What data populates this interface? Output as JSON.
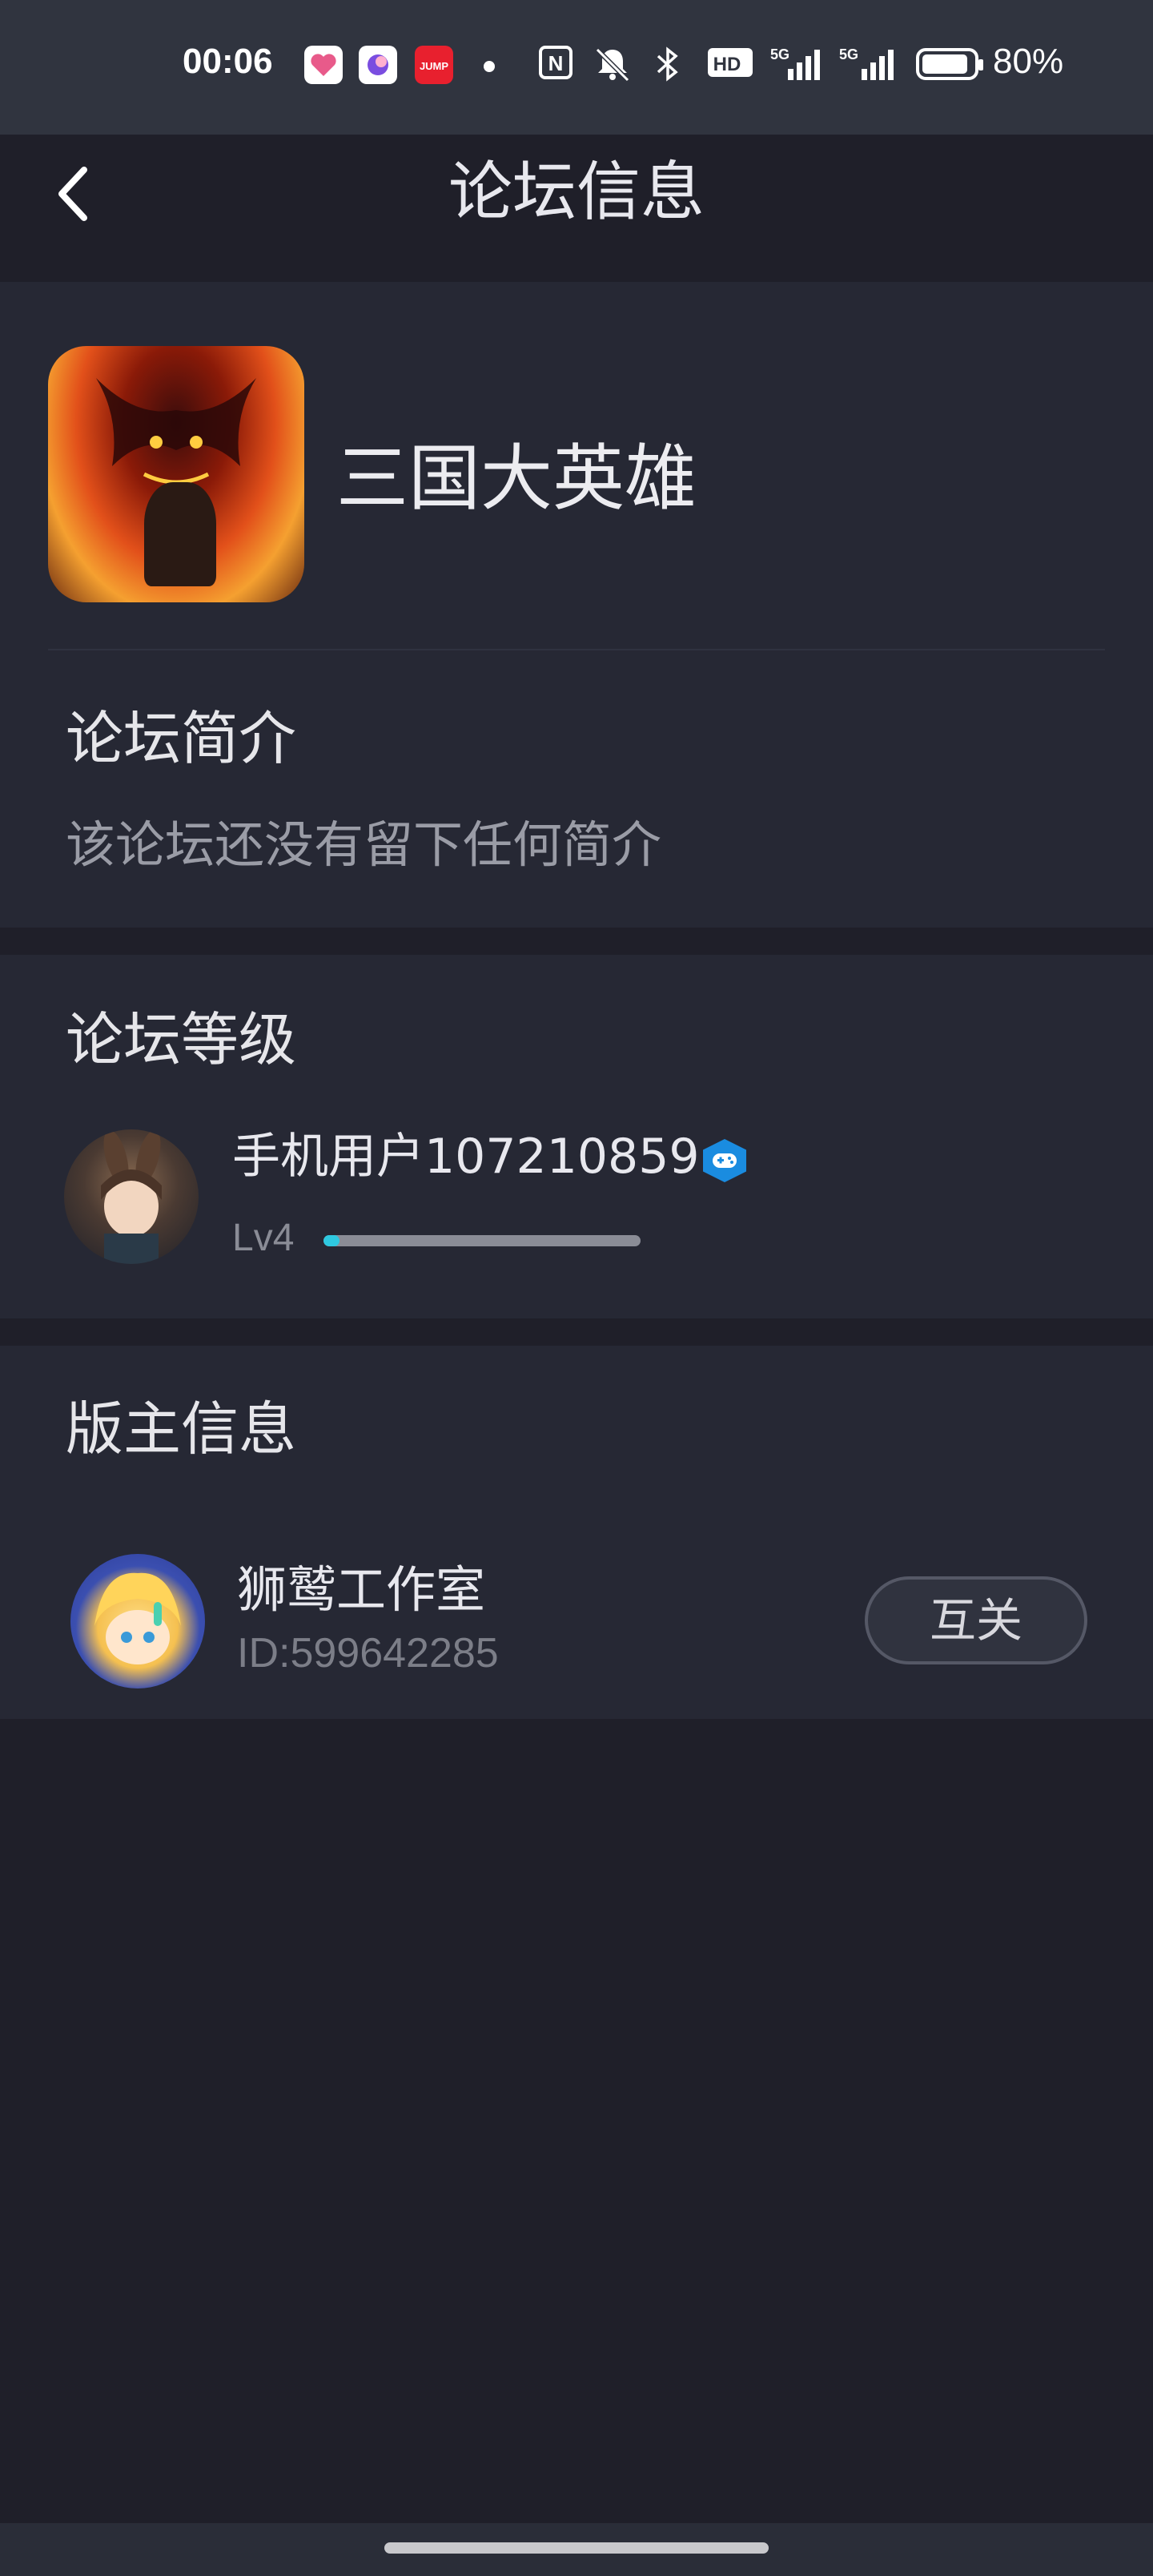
{
  "status_bar": {
    "time": "00:06",
    "battery": "80%",
    "icons": [
      "heart-app-icon",
      "circle-app-icon",
      "jump-app-icon",
      "dot-icon",
      "nfc-icon",
      "mute-icon",
      "bluetooth-icon",
      "hd-icon",
      "5g-signal-icon",
      "5g-signal-icon",
      "battery-icon"
    ],
    "nfc_glyph": "N",
    "hd_glyph": "HD",
    "signal1": "5G",
    "signal2": "5G",
    "jump_label": "JUMP"
  },
  "nav": {
    "title": "论坛信息",
    "back_icon": "chevron-left-icon"
  },
  "forum": {
    "name": "三国大英雄",
    "intro_title": "论坛简介",
    "intro_text": "该论坛还没有留下任何简介"
  },
  "level": {
    "section_title": "论坛等级",
    "user_name": "手机用户107210859",
    "level_label": "Lv4",
    "progress": 0.05,
    "progress_color": "#2ec8e0",
    "badge_color": "#1a8ce0"
  },
  "moderators": {
    "section_title": "版主信息",
    "items": [
      {
        "name": "狮鹫工作室",
        "id": "ID:599642285",
        "button": "互关"
      }
    ]
  },
  "colors": {
    "background": "#1f1f29",
    "card": "#262834",
    "header": "#30343f"
  }
}
